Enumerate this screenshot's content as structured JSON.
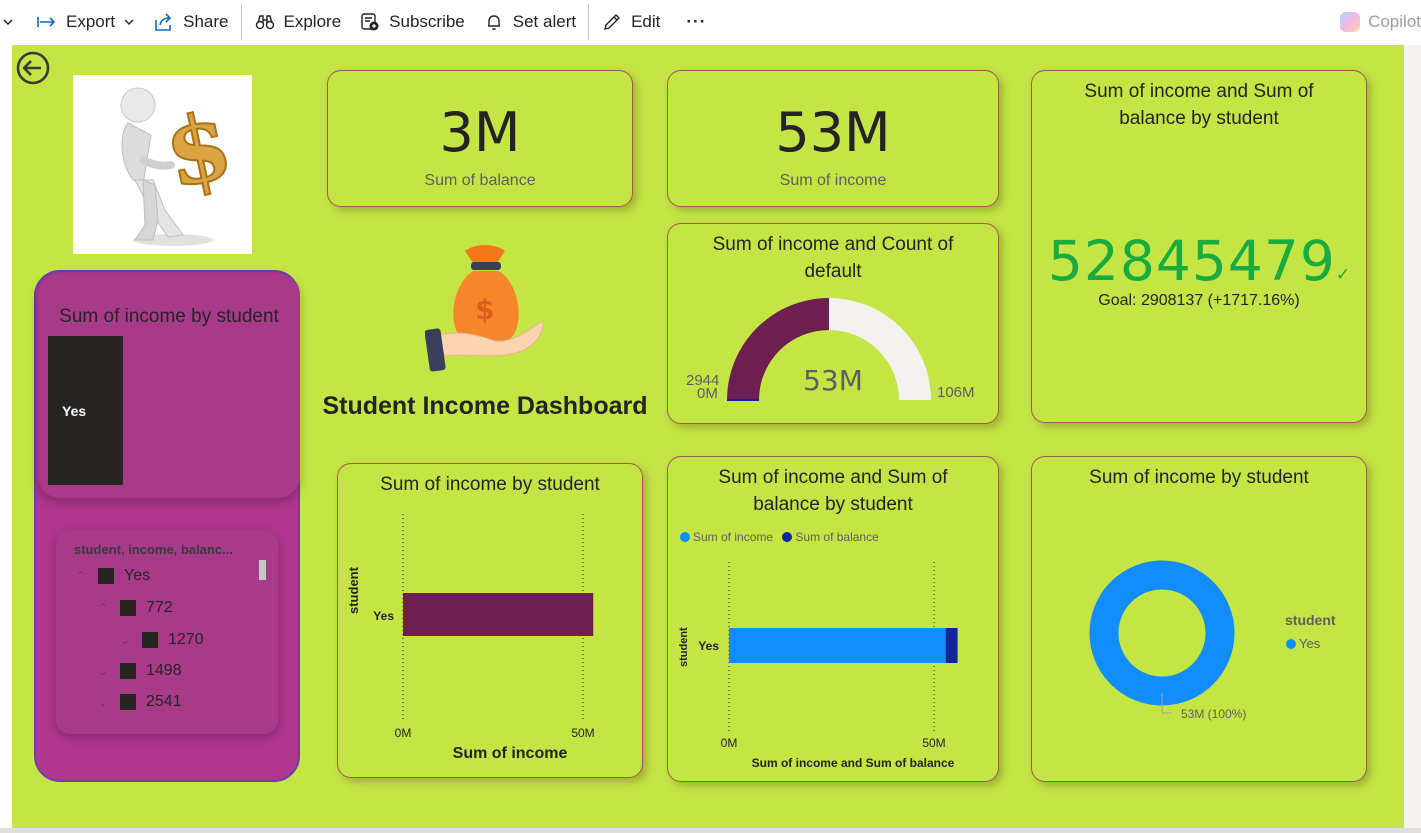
{
  "toolbar": {
    "export": "Export",
    "share": "Share",
    "explore": "Explore",
    "subscribe": "Subscribe",
    "set_alert": "Set alert",
    "edit": "Edit",
    "more": "···",
    "copilot": "Copilot"
  },
  "dashboard": {
    "title": "Student Income Dashboard"
  },
  "kpi_balance": {
    "value": "3M",
    "label": "Sum of balance"
  },
  "kpi_income": {
    "value": "53M",
    "label": "Sum of income"
  },
  "gauge": {
    "title": "Sum of income and Count of default",
    "value_label": "53M",
    "min_label": "0M",
    "max_label": "106M",
    "target_label": "2944",
    "fill_fraction": 0.5
  },
  "goal_kpi": {
    "title": "Sum of income and Sum of balance by student",
    "value": "52845479",
    "check": "✓",
    "goal": "Goal: 2908137 (+1717.16%)"
  },
  "purple_chart": {
    "title": "Sum of income by student",
    "bar_label": "Yes"
  },
  "slicer": {
    "header": "student, income, balanc...",
    "items": [
      {
        "label": "Yes",
        "level": 0,
        "chevron": "⌃"
      },
      {
        "label": "772",
        "level": 1,
        "chevron": "⌃"
      },
      {
        "label": "1270",
        "level": 2,
        "chevron": "⌄"
      },
      {
        "label": "1498",
        "level": 1,
        "chevron": "⌄"
      },
      {
        "label": "2541",
        "level": 1,
        "chevron": "⌄"
      }
    ]
  },
  "bar_chart1": {
    "title": "Sum of income by student",
    "ylabel": "student",
    "xlabel": "Sum of income",
    "ticks": [
      "0M",
      "50M"
    ]
  },
  "bar_chart2": {
    "title": "Sum of income and Sum of balance by student",
    "ylabel": "student",
    "xlabel": "Sum of income and Sum of balance",
    "ticks": [
      "0M",
      "50M"
    ],
    "legend": [
      "Sum of income",
      "Sum of balance"
    ]
  },
  "donut": {
    "title": "Sum of income by student",
    "legend_title": "student",
    "legend_item": "Yes",
    "data_label": "53M (100%)"
  },
  "chart_data": [
    {
      "type": "bar",
      "title": "Sum of income by student",
      "categories": [
        "Yes"
      ],
      "values": [
        52845479
      ],
      "xlabel": "Sum of income",
      "ylabel": "student",
      "xlim": [
        0,
        50000000
      ]
    },
    {
      "type": "bar",
      "title": "Sum of income and Sum of balance by student",
      "categories": [
        "Yes"
      ],
      "series": [
        {
          "name": "Sum of income",
          "values": [
            52845479
          ],
          "color": "#118dff"
        },
        {
          "name": "Sum of balance",
          "values": [
            2908137
          ],
          "color": "#12239e"
        }
      ],
      "xlabel": "Sum of income and Sum of balance",
      "ylabel": "student",
      "xlim": [
        0,
        50000000
      ]
    },
    {
      "type": "pie",
      "title": "Sum of income by student",
      "categories": [
        "Yes"
      ],
      "values": [
        52845479
      ],
      "legend": "right"
    }
  ],
  "colors": {
    "canvas": "#c5e545",
    "purple": "#b0368f",
    "bar_dark": "#6d1f52",
    "income_blue": "#118dff",
    "balance_navy": "#12239e",
    "kpi_green": "#1aab40"
  }
}
